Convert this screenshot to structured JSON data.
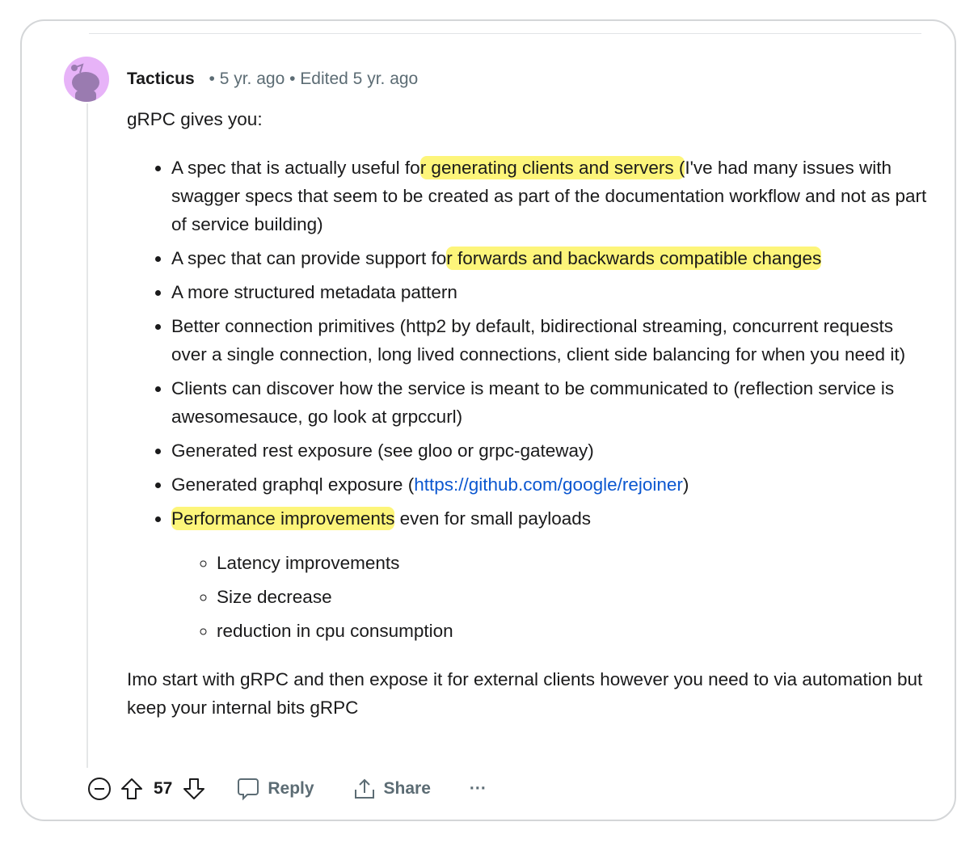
{
  "comment": {
    "username": "Tacticus",
    "posted": "5 yr. ago",
    "edited": "Edited 5 yr. ago",
    "intro": "gRPC gives you:",
    "items": [
      [
        {
          "t": "A spec that is actually useful fo"
        },
        {
          "t": "r generating clients and servers (",
          "hl": true
        },
        {
          "t": "I've had many issues with swagger specs that seem to be created as part of the documentation workflow and not as part of service building)"
        }
      ],
      [
        {
          "t": "A spec that can provide support fo"
        },
        {
          "t": "r forwards and backwards compatible changes",
          "hl": true
        }
      ],
      [
        {
          "t": "A more structured metadata pattern"
        }
      ],
      [
        {
          "t": "Better connection primitives (http2 by default, bidirectional streaming, concurrent requests over a single connection, long lived connections, client side balancing for when you need it)"
        }
      ],
      [
        {
          "t": "Clients can discover how the service is meant to be communicated to (reflection service is awesomesauce, go look at grpccurl)"
        }
      ],
      [
        {
          "t": "Generated rest exposure (see gloo or grpc-gateway)"
        }
      ],
      [
        {
          "t": "Generated graphql exposure ("
        },
        {
          "t": "https://github.com/google/rejoiner",
          "link": true
        },
        {
          "t": ")"
        }
      ],
      [
        {
          "t": "Performance improvements",
          "hl": true
        },
        {
          "t": " even for small payloads"
        }
      ]
    ],
    "subitems": [
      "Latency improvements",
      "Size decrease",
      "reduction in cpu consumption"
    ],
    "closing": "Imo start with gRPC and then expose it for external clients however you need to via automation but keep your internal bits gRPC"
  },
  "actions": {
    "score": "57",
    "reply": "Reply",
    "share": "Share",
    "more": "···"
  }
}
